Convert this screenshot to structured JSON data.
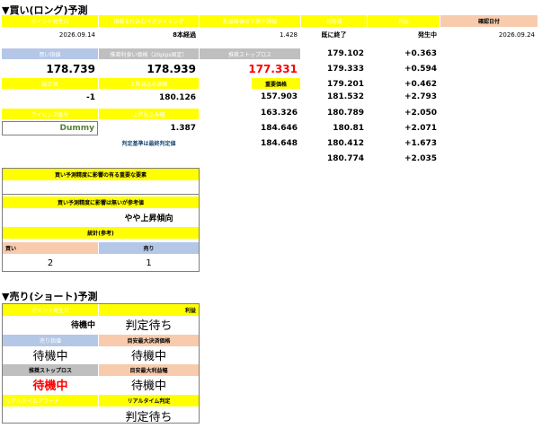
{
  "long": {
    "title": "▼買い(ロング)予測",
    "headers": {
      "point_date": "ポイント発生日",
      "entry_timing": "指値を仕込むべきタイミング",
      "profit_target": "利益確保の下落予想幅",
      "valid_value": "有効値",
      "profit": "利益",
      "confirm_date": "確認日付"
    },
    "row1": {
      "point_date": "2026.09.14",
      "entry_timing": "8本経過",
      "profit_target": "1.428",
      "valid_value": "既に終了",
      "profit": "発生中",
      "confirm_date": "2026.09.24"
    },
    "buy_limit_label": "買い指値",
    "recommended_buy_label": "推奨利食い価格（20pips固定）",
    "stoploss_label": "推奨ストップロス",
    "buy_limit_value": "178.739",
    "recommended_buy_value": "178.939",
    "stoploss_value": "177.331",
    "settlement_label": "結合値",
    "upper_expected_label": "上昇見込み価格",
    "important_label": "重要価格",
    "settlement_value": "-1",
    "upper_expected_value": "180.126",
    "license_label": "ライセンス番号",
    "upper_expected_width_label": "上昇見込み幅",
    "license_value": "Dummy",
    "upper_expected_width_value": "1.387",
    "note": "判定基準は最終判定値",
    "important_prices": [
      "157.903",
      "163.326",
      "184.646",
      "184.648"
    ],
    "valid_values": [
      "179.102",
      "179.333",
      "179.201",
      "181.532",
      "180.789",
      "180.81",
      "180.412",
      "180.774"
    ],
    "profits": [
      "+0.363",
      "+0.594",
      "+0.462",
      "+2.793",
      "+2.050",
      "+2.071",
      "+1.673",
      "+2.035"
    ],
    "box": {
      "q1": "買い予測精度に影響の有る重要な要素",
      "q1_value": "",
      "q2": "買い予測精度に影響は無いが参考値",
      "q2_value": "やや上昇傾向",
      "stats_label": "統計(参考)",
      "buy_label": "買い",
      "sell_label": "売り",
      "buy_value": "2",
      "sell_value": "1"
    }
  },
  "short": {
    "title": "▼売り(ショート)予測",
    "point_date_label": "ポイント発生日",
    "profit_label": "利益",
    "point_date_value": "待機中",
    "profit_value": "判定待ち",
    "sell_limit_label": "売り指値",
    "recommended_label": "目安最大決済価格",
    "sell_limit_value": "待機中",
    "recommended_value": "待機中",
    "stoploss_label": "推奨ストップロス",
    "max_profit_label": "目安最大利益幅",
    "stoploss_value": "待機中",
    "max_profit_value": "待機中",
    "realtime_alert_label": "リアルタイムアラート",
    "realtime_judge_label": "リアルタイム判定",
    "realtime_alert_value": "",
    "realtime_judge_value": "判定待ち"
  }
}
